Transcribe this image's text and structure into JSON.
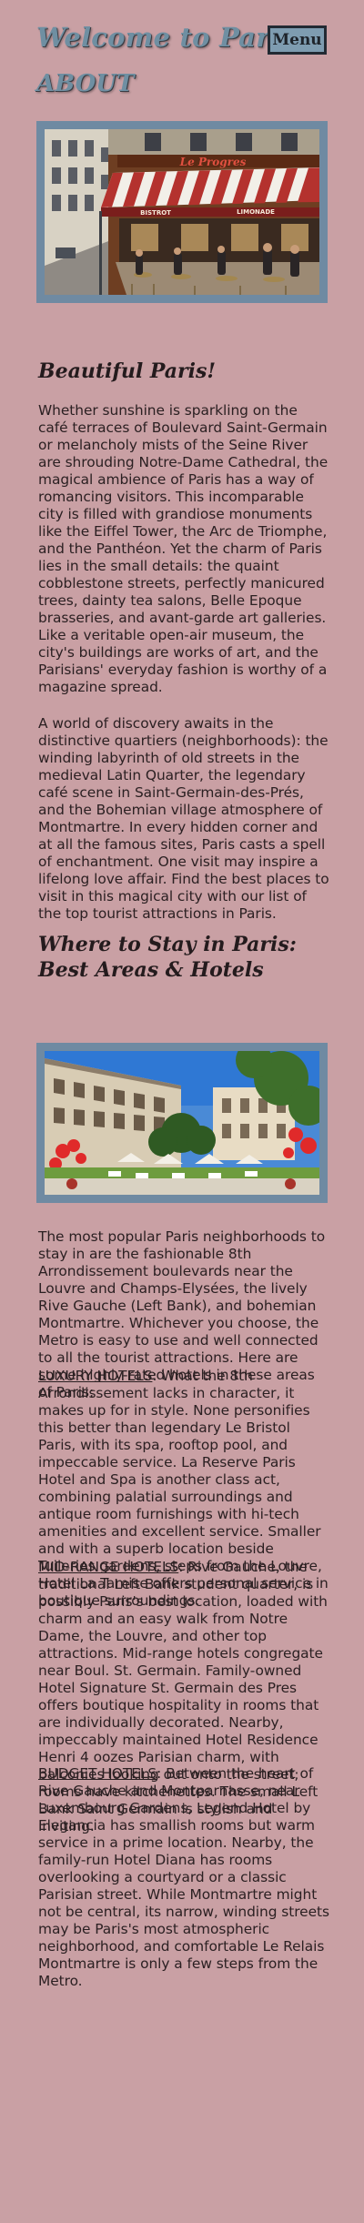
{
  "header": {
    "title": "Welcome to Paris!",
    "menu_label": "Menu"
  },
  "about": {
    "label": "ABOUT"
  },
  "section1": {
    "heading": "Beautiful Paris!",
    "image_sign": "Le Progres",
    "image_awning_left": "BISTROT",
    "image_awning_right": "LIMONADE",
    "paragraphs": [
      "Whether sunshine is sparkling on the café terraces of Boulevard Saint-Germain or melancholy mists of the Seine River are shrouding Notre-Dame Cathedral, the magical ambience of Paris has a way of romancing visitors. This incomparable city is filled with grandiose monuments like the Eiffel Tower, the Arc de Triomphe, and the Panthéon. Yet the charm of Paris lies in the small details: the quaint cobblestone streets, perfectly manicured trees, dainty tea salons, Belle Epoque brasseries, and avant-garde art galleries. Like a veritable open-air museum, the city's buildings are works of art, and the Parisians' everyday fashion is worthy of a magazine spread.",
      "A world of discovery awaits in the distinctive quartiers (neighborhoods): the winding labyrinth of old streets in the medieval Latin Quarter, the legendary café scene in Saint-Germain-des-Prés, and the Bohemian village atmosphere of Montmartre. In every hidden corner and at all the famous sites, Paris casts a spell of enchantment. One visit may inspire a lifelong love affair. Find the best places to visit in this magical city with our list of the top tourist attractions in Paris."
    ]
  },
  "section2": {
    "heading": "Where to Stay in Paris: Best Areas & Hotels",
    "intro": "The most popular Paris neighborhoods to stay in are the fashionable 8th Arrondissement boulevards near the Louvre and Champs-Elysées, the lively Rive Gauche (Left Bank), and bohemian Montmartre. Whichever you choose, the Metro is easy to use and well connected to all the tourist attractions. Here are some highly-rated hotels in these areas of Paris:",
    "luxury_label": "LUXURY HOTELS",
    "luxury_text": ": What the 8th Arrondissement lacks in character, it makes up for in style. None personifies this better than legendary Le Bristol Paris, with its spa, rooftop pool, and impeccable service. La Reserve Paris Hotel and Spa is another class act, combining palatial surroundings and antique room furnishings with hi-tech amenities and excellent service. Smaller and with a superb location beside Tuileries gardens, steps from the Louvre, Hotel La Tamise offers personal service in boutique surroundings.",
    "midrange_label": "MID-RANGE HOTELS",
    "midrange_text": ": Rive Gauche, the traditional Left Bank student quarter, is possibly Paris's best location, loaded with charm and an easy walk from Notre Dame, the Louvre, and other top attractions. Mid-range hotels congregate near Boul. St. Germain. Family-owned Hotel Signature St. Germain des Pres offers boutique hospitality in rooms that are individually decorated. Nearby, impeccably maintained Hotel Residence Henri 4 oozes Parisian charm, with balconies looking out onto the street; rooms have kitchenettes. The small Left Bank Saint Germain is stylish and inviting.",
    "budget_label": "BUDGET HOTELS",
    "budget_text": ": Between the heart of Rive Gauche and Montparnasse, near Luxembourg Gardens, Legend Hotel by Elegancia has smallish rooms but warm service in a prime location. Nearby, the family-run Hotel Diana has rooms overlooking a courtyard or a classic Parisian street. While Montmartre might not be central, its narrow, winding streets may be Paris's most atmospheric neighborhood, and comfortable Le Relais Montmartre is only a few steps from the Metro."
  }
}
